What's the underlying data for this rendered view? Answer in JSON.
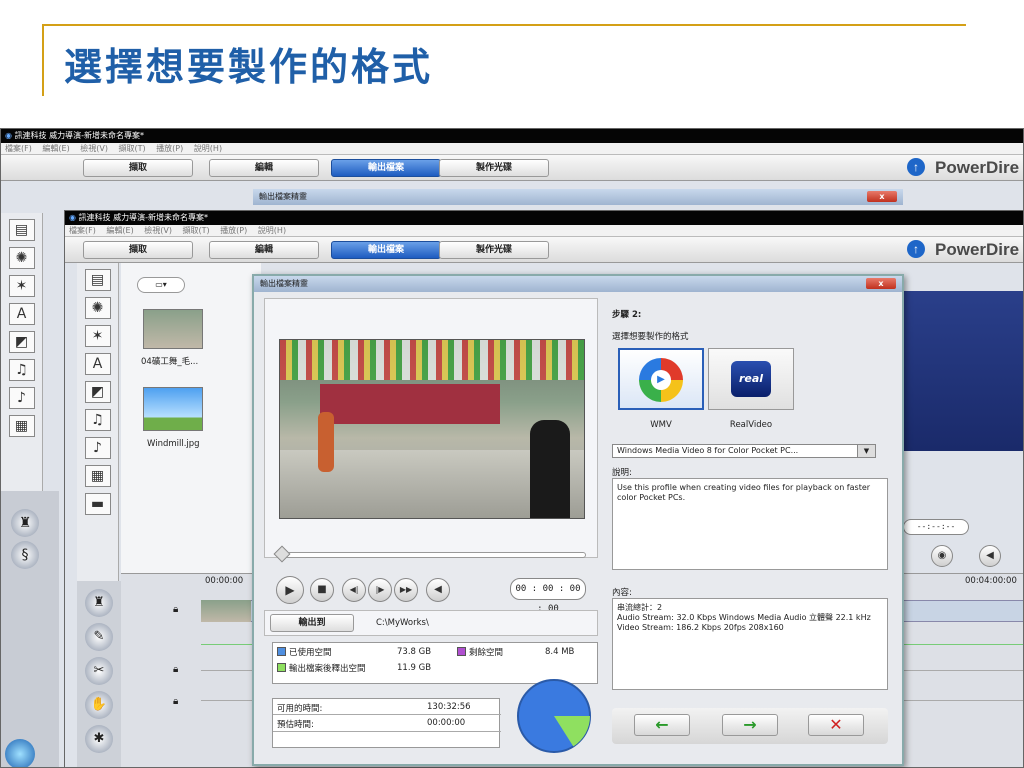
{
  "slide": {
    "title": "選擇想要製作的格式"
  },
  "back_window": {
    "title": "訊連科技 威力導演-新增未命名專案*",
    "menu": [
      "檔案(F)",
      "編輯(E)",
      "檢視(V)",
      "擷取(T)",
      "播放(P)",
      "說明(H)"
    ],
    "tabs": [
      "擷取",
      "編輯",
      "輸出檔案",
      "製作光碟"
    ],
    "brand": "PowerDire",
    "dialog_title": "輸出檔案精靈"
  },
  "front_window": {
    "title": "訊連科技 威力導演-新增未命名專案*",
    "menu": [
      "檔案(F)",
      "編輯(E)",
      "檢視(V)",
      "擷取(T)",
      "播放(P)",
      "說明(H)"
    ],
    "tabs": [
      "擷取",
      "編輯",
      "輸出檔案",
      "製作光碟"
    ],
    "brand": "PowerDire"
  },
  "library": {
    "items": [
      {
        "label": "04礦工舞_毛..."
      },
      {
        "label": "Windmill.jpg"
      }
    ],
    "timecode": "00:00:00",
    "ruler_end": "00:04:00:00",
    "time_field": "--:--:--"
  },
  "dialog": {
    "title": "輸出檔案精靈",
    "close_label": "x",
    "playback": {
      "timecode": "00 : 00 : 00 : 00"
    },
    "output": {
      "button_label": "輸出到",
      "path": "C:\\MyWorks\\"
    },
    "disk": {
      "used_label": "已使用空間",
      "used_value": "73.8 GB",
      "remaining_label": "剩餘空間",
      "remaining_value": "8.4 MB",
      "after_label": "輸出檔案後釋出空間",
      "after_value": "11.9 GB",
      "used_fraction": 0.84,
      "colors": {
        "used": "#4f8fe0",
        "remaining": "#b050d0",
        "after": "#8fe060"
      }
    },
    "time": {
      "available_label": "可用的時間:",
      "available_value": "130:32:56",
      "estimated_label": "預估時間:",
      "estimated_value": "00:00:00"
    },
    "step": {
      "title": "步驟 2:",
      "prompt": "選擇想要製作的格式",
      "formats": [
        {
          "name": "WMV",
          "icon": "wmv-format-icon",
          "selected": true
        },
        {
          "name": "RealVideo",
          "icon": "realvideo-format-icon",
          "selected": false
        }
      ],
      "real_badge": "real",
      "profile_value": "Windows Media Video 8 for Color Pocket PC...",
      "description_label": "說明:",
      "description": "Use this profile when creating video files for playback on faster color Pocket PCs.",
      "content_label": "內容:",
      "content_lines": [
        "串流總計：2",
        "Audio Stream:  32.0 Kbps  Windows Media Audio  立體聲  22.1 kHz",
        "Video Stream:  186.2 Kbps  20fps  208x160"
      ]
    },
    "nav": {
      "back": "←",
      "next": "→",
      "cancel": "✕"
    }
  }
}
